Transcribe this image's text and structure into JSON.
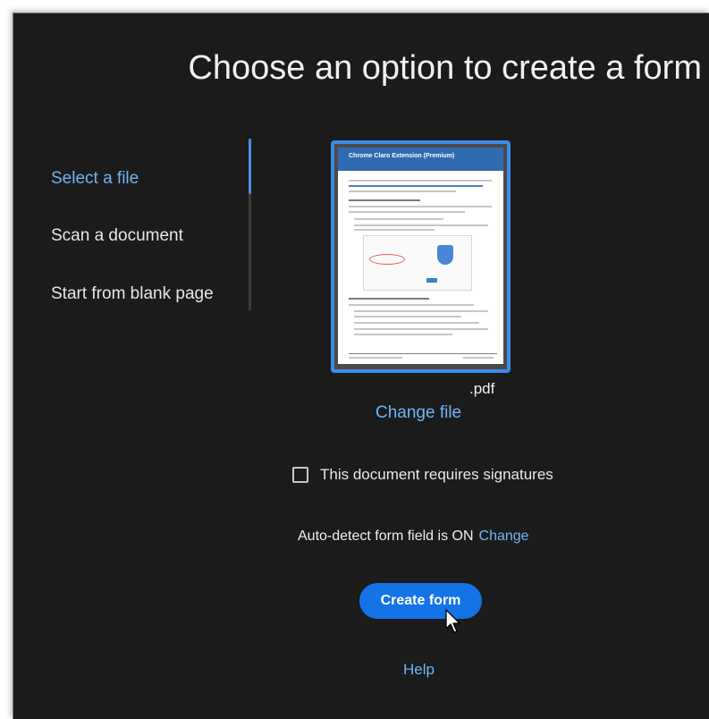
{
  "dialog": {
    "title": "Choose an option to create a form"
  },
  "nav": {
    "items": [
      {
        "label": "Select a file",
        "active": true
      },
      {
        "label": "Scan a document",
        "active": false
      },
      {
        "label": "Start from blank page",
        "active": false
      }
    ]
  },
  "file": {
    "preview_title": "Chrome Claro Extension (Premium)",
    "name": ".pdf",
    "change_label": "Change file"
  },
  "signatures": {
    "label": "This document requires signatures",
    "checked": false
  },
  "autodetect": {
    "text": "Auto-detect form field is ON",
    "change_label": "Change"
  },
  "actions": {
    "create_label": "Create form",
    "help_label": "Help"
  },
  "colors": {
    "background": "#1b1b1b",
    "accent": "#1473e6",
    "link": "#6eb5f5",
    "thumbnail_border": "#3b8bea"
  },
  "icons": {
    "checkbox": "checkbox-unchecked-icon",
    "cursor": "mouse-pointer-icon"
  }
}
